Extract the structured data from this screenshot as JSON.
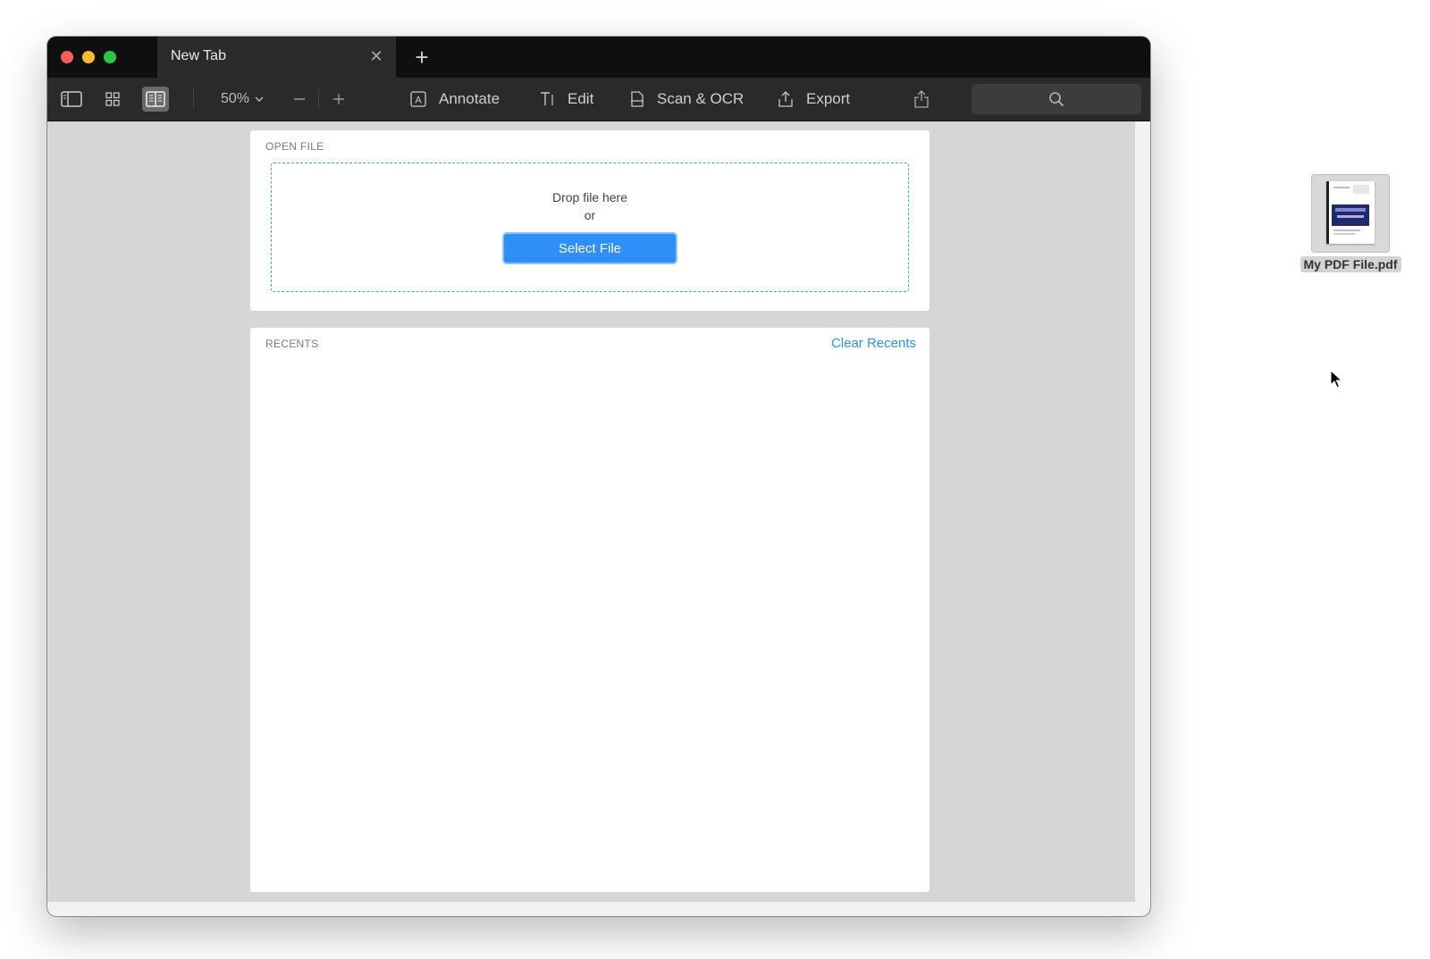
{
  "window": {
    "tab_title": "New Tab",
    "tab_close_icon": "close-icon",
    "new_tab_icon": "plus-icon"
  },
  "toolbar": {
    "sidebar_icon": "sidebar-icon",
    "grid_icon": "grid-view-icon",
    "reading_icon": "reading-view-icon",
    "zoom": "50%",
    "zoom_out_icon": "minus-icon",
    "zoom_in_icon": "plus-icon",
    "annotate_label": "Annotate",
    "edit_label": "Edit",
    "scan_label": "Scan & OCR",
    "export_label": "Export",
    "share_icon": "share-icon",
    "search_icon": "search-icon"
  },
  "open_file": {
    "section_label": "OPEN FILE",
    "drop_text": "Drop file here",
    "or_text": "or",
    "select_button": "Select File"
  },
  "recents": {
    "section_label": "RECENTS",
    "clear_link": "Clear Recents"
  },
  "desktop": {
    "file_name": "My PDF File.pdf"
  },
  "colors": {
    "accent": "#2f8ff6",
    "titlebar": "#0f0f0f",
    "toolbar": "#2a2a2a",
    "canvas": "#d6d6d6"
  }
}
